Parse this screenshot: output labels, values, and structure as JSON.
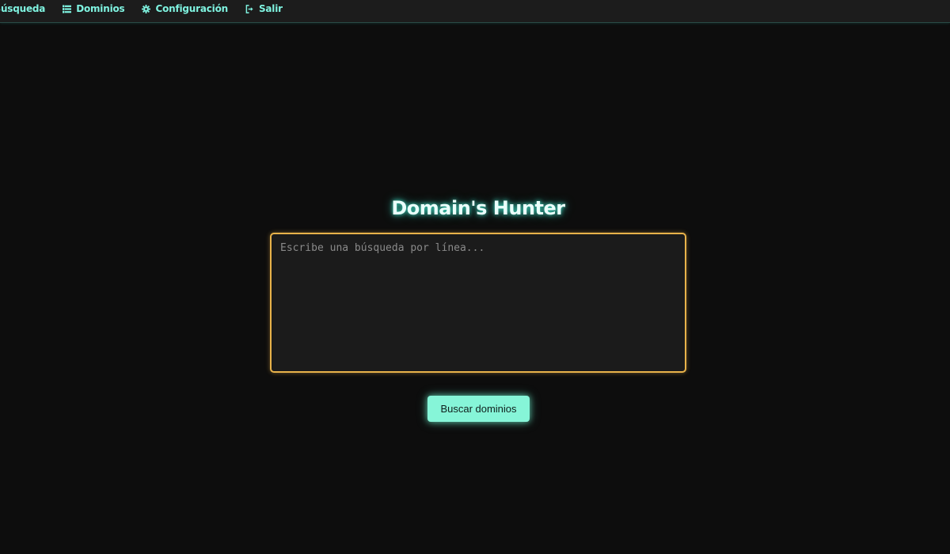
{
  "nav": {
    "items": [
      {
        "label": "Búsqueda",
        "icon": "search-icon"
      },
      {
        "label": "Dominios",
        "icon": "list-icon"
      },
      {
        "label": "Configuración",
        "icon": "gear-icon"
      },
      {
        "label": "Salir",
        "icon": "logout-icon"
      }
    ]
  },
  "main": {
    "title": "Domain's Hunter",
    "query": {
      "value": "",
      "placeholder": "Escribe una búsqueda por línea..."
    },
    "search_button_label": "Buscar dominios"
  },
  "colors": {
    "accent": "#7ff3e0",
    "button": "#86f5d8",
    "input_border": "#e8b24a",
    "background": "#0d0d0d",
    "topbar": "#1c1c1c"
  }
}
